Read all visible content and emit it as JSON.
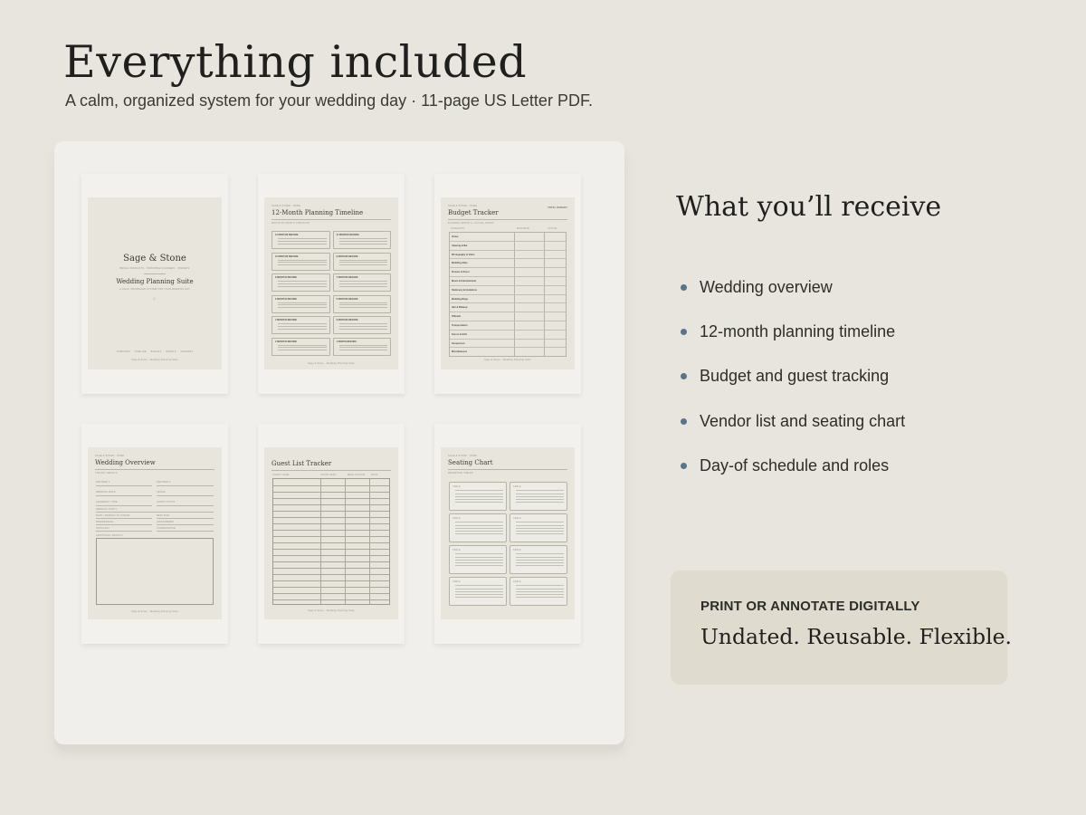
{
  "header": {
    "title": "Everything included",
    "subtitle": "A calm, organized system for your wedding day · 11-page US Letter PDF."
  },
  "previews": {
    "cover": {
      "brand": "Sage & Stone",
      "tagline": "BRIDAL PRODUCTS · PRINTABLE PLANNERS · PRESETS",
      "title": "Wedding Planning Suite",
      "description": "A CALM, ORGANIZED SYSTEM FOR YOUR WEDDING DAY",
      "nav": "OVERVIEW TIMELINE BUDGET GUESTS VENDORS",
      "footer": "Sage & Stone · Wedding Planning Suite"
    },
    "timeline": {
      "brand": "SAGE & STONE · HOME",
      "title": "12-Month Planning Timeline",
      "subtitle": "MONTH-BY-MONTH CHECKLIST",
      "months": [
        "12 MONTHS BEFORE",
        "11 MONTHS BEFORE",
        "10 MONTHS BEFORE",
        "9 MONTHS BEFORE",
        "8 MONTHS BEFORE",
        "7 MONTHS BEFORE",
        "6 MONTHS BEFORE",
        "5 MONTHS BEFORE",
        "4 MONTHS BEFORE",
        "3 MONTHS BEFORE",
        "2 MONTHS BEFORE",
        "1 MONTH BEFORE"
      ],
      "footer": "Sage & Stone · Wedding Planning Suite"
    },
    "budget": {
      "brand": "SAGE & STONE · HOME",
      "title": "Budget Tracker",
      "total_label": "TOTAL BUDGET",
      "subtitle": "PLANNED SPEND vs. ACTUAL SPEND",
      "columns": [
        "CATEGORY",
        "ESTIMATE",
        "ACTUAL"
      ],
      "rows": [
        "Venue",
        "Catering & Bar",
        "Photography & Video",
        "Wedding Attire",
        "Flowers & Decor",
        "Music & Entertainment",
        "Stationery & Invitations",
        "Wedding Rings",
        "Hair & Makeup",
        "Officiant",
        "Transportation",
        "Favors & Gifts",
        "Honeymoon",
        "Miscellaneous"
      ],
      "footer": "Sage & Stone · Wedding Planning Suite"
    },
    "overview": {
      "brand": "SAGE & STONE · HOME",
      "title": "Wedding Overview",
      "subtitle": "THE KEY DETAILS",
      "fields": [
        "PARTNER 1",
        "PARTNER 2",
        "WEDDING DATE",
        "VENUE",
        "CEREMONY TIME",
        "GUEST COUNT",
        "WEDDING PARTY",
        "MAID / MATRON OF HONOR",
        "BEST MAN",
        "BRIDESMAIDS",
        "GROOMSMEN",
        "OFFICIANT",
        "COORDINATOR"
      ],
      "notes_label": "ADDITIONAL DETAILS",
      "footer": "Sage & Stone · Wedding Planning Suite"
    },
    "guests": {
      "title": "Guest List Tracker",
      "columns": [
        "GUEST NAME",
        "INVITE SENT",
        "MEAL CHOICE",
        "RSVP"
      ],
      "footer": "Sage & Stone · Wedding Planning Suite"
    },
    "seating": {
      "brand": "SAGE & STONE · HOME",
      "title": "Seating Chart",
      "subtitle": "RECEPTION TABLES",
      "table_label": "TABLE",
      "footer": "Sage & Stone · Wedding Planning Suite"
    }
  },
  "receive": {
    "title": "What you’ll receive",
    "items": [
      "Wedding overview",
      "12-month planning timeline",
      "Budget and guest tracking",
      "Vendor list and seating chart",
      "Day-of schedule and roles"
    ]
  },
  "callout": {
    "kicker": "PRINT OR ANNOTATE DIGITALLY",
    "text": "Undated. Reusable. Flexible."
  },
  "colors": {
    "background": "#e8e5de",
    "panel": "#f0efeb",
    "sheet": "#e7e5dc",
    "bullet": "#59738a",
    "callout": "#dfdccf"
  }
}
